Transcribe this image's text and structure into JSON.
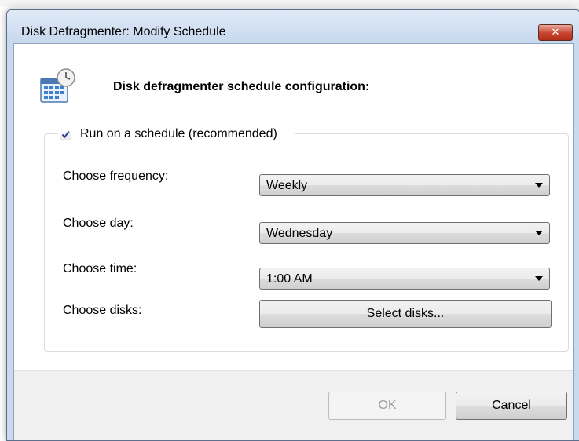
{
  "dialog": {
    "title": "Disk Defragmenter: Modify Schedule",
    "close_glyph": "✕",
    "heading": "Disk defragmenter schedule configuration:",
    "icon": "calendar-clock-icon"
  },
  "schedule": {
    "checkbox_label": "Run on a schedule (recommended)",
    "checked": true,
    "frequency": {
      "label": "Choose frequency:",
      "value": "Weekly"
    },
    "day": {
      "label": "Choose day:",
      "value": "Wednesday"
    },
    "time": {
      "label": "Choose time:",
      "value": "1:00 AM"
    },
    "disks": {
      "label": "Choose disks:",
      "button_label": "Select disks..."
    }
  },
  "buttons": {
    "ok": "OK",
    "cancel": "Cancel"
  },
  "colors": {
    "close_button": "#c7432e",
    "checkmark": "#243d8c"
  }
}
